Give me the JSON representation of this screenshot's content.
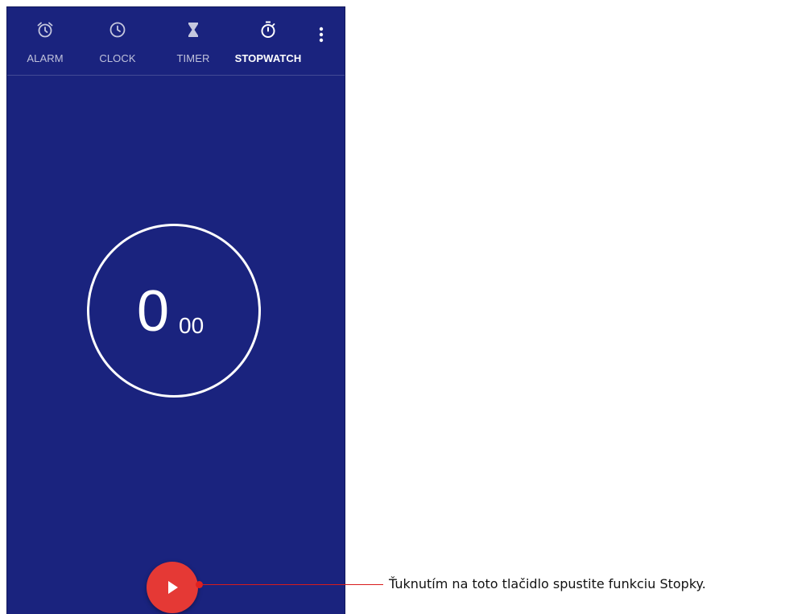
{
  "tabs": [
    {
      "label": "ALARM",
      "icon": "alarm-icon",
      "active": false
    },
    {
      "label": "CLOCK",
      "icon": "clock-icon",
      "active": false
    },
    {
      "label": "TIMER",
      "icon": "hourglass-icon",
      "active": false
    },
    {
      "label": "STOPWATCH",
      "icon": "stopwatch-icon",
      "active": true
    }
  ],
  "menu": {
    "icon": "more-vertical-icon"
  },
  "stopwatch": {
    "seconds": "0",
    "hundredths": "00"
  },
  "fab": {
    "icon": "play-icon"
  },
  "callout": {
    "text": "Ťuknutím na toto tlačidlo spustite funkciu Stopky."
  },
  "colors": {
    "background": "#1a237e",
    "fab": "#e53935",
    "callout_line": "#d81b1b",
    "text_active": "#ffffff"
  }
}
